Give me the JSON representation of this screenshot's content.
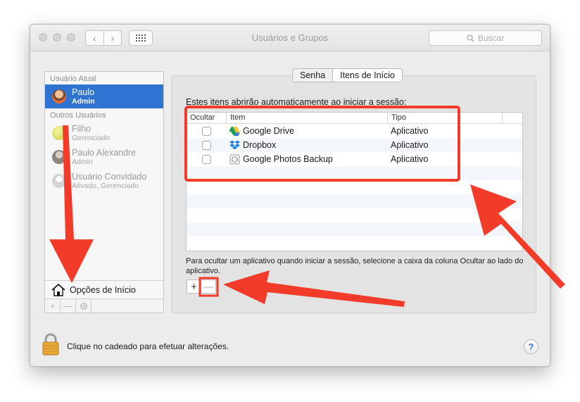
{
  "window": {
    "title": "Usuários e Grupos"
  },
  "toolbar": {
    "back_glyph": "‹",
    "forward_glyph": "›",
    "search_placeholder": "Buscar"
  },
  "sidebar": {
    "current_header": "Usuário Atual",
    "current_user": {
      "name": "Paulo",
      "role": "Admin"
    },
    "others_header": "Outros Usuários",
    "others": [
      {
        "name": "Filho",
        "role": "Gerenciado"
      },
      {
        "name": "Paulo Alexandre",
        "role": "Admin"
      },
      {
        "name": "Usuário Convidado",
        "role": "Ativado, Gerenciado"
      }
    ],
    "login_options": "Opções de Início",
    "add_glyph": "+",
    "remove_glyph": "—"
  },
  "tabs": [
    {
      "label": "Senha",
      "active": true
    },
    {
      "label": "Itens de Início",
      "active": false
    }
  ],
  "main": {
    "intro": "Estes itens abrirão automaticamente ao iniciar a sessão:",
    "columns": {
      "hide": "Ocultar",
      "item": "Item",
      "type": "Tipo"
    },
    "rows": [
      {
        "hide": false,
        "icon": "google-drive-icon",
        "item": "Google Drive",
        "type": "Aplicativo"
      },
      {
        "hide": false,
        "icon": "dropbox-icon",
        "item": "Dropbox",
        "type": "Aplicativo"
      },
      {
        "hide": false,
        "icon": "google-photos-backup-icon",
        "item": "Google Photos Backup",
        "type": "Aplicativo"
      }
    ],
    "hint": "Para ocultar um aplicativo quando iniciar a sessão, selecione a caixa da coluna Ocultar ao lado do aplicativo.",
    "add_glyph": "+",
    "remove_glyph": "—"
  },
  "footer": {
    "lock_text": "Clique no cadeado para efetuar alterações.",
    "help_glyph": "?"
  },
  "colors": {
    "accent": "#2f74d0",
    "annotation": "#f33b2a"
  }
}
